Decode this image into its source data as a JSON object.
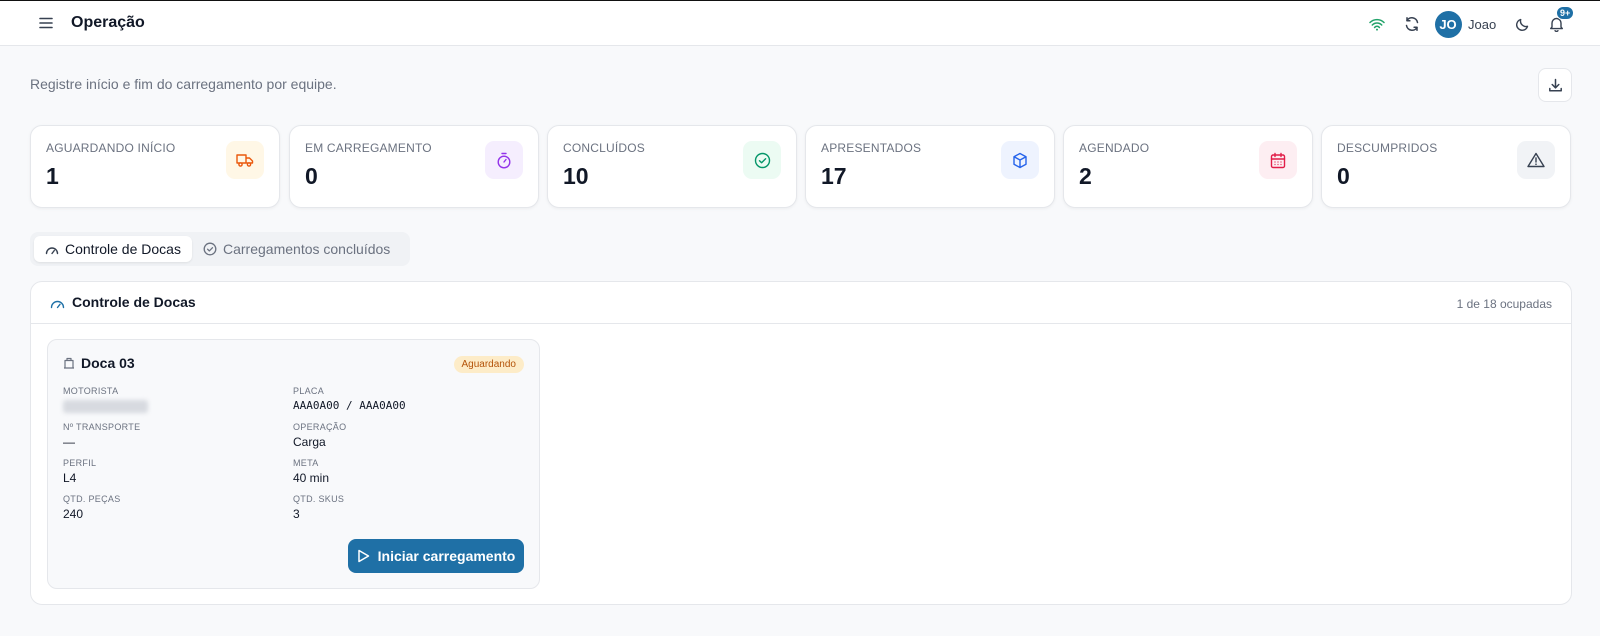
{
  "header": {
    "title": "Operação",
    "user": {
      "initials": "JO",
      "name": "Joao"
    },
    "notifications_badge": "9+",
    "icons": [
      "menu-icon",
      "wifi-icon",
      "refresh-icon",
      "moon-icon",
      "bell-icon"
    ]
  },
  "page": {
    "subtitle": "Registre início e fim do carregamento por equipe."
  },
  "stats": [
    {
      "label": "AGUARDANDO INÍCIO",
      "value": "1",
      "icon": "truck-icon",
      "color": "#ea580c",
      "bg": "#fff7e6"
    },
    {
      "label": "EM CARREGAMENTO",
      "value": "0",
      "icon": "timer-icon",
      "color": "#9333ea",
      "bg": "#f5eefe"
    },
    {
      "label": "CONCLUÍDOS",
      "value": "10",
      "icon": "check-circle-icon",
      "color": "#059669",
      "bg": "#ecfbf3"
    },
    {
      "label": "APRESENTADOS",
      "value": "17",
      "icon": "package-icon",
      "color": "#2563eb",
      "bg": "#eef3fe"
    },
    {
      "label": "AGENDADO",
      "value": "2",
      "icon": "calendar-icon",
      "color": "#e11d48",
      "bg": "#fdeef2"
    },
    {
      "label": "DESCUMPRIDOS",
      "value": "0",
      "icon": "warning-icon",
      "color": "#374151",
      "bg": "#f1f3f6"
    }
  ],
  "tabs": [
    {
      "label": "Controle de Docas",
      "active": true
    },
    {
      "label": "Carregamentos concluídos",
      "active": false
    }
  ],
  "panel": {
    "title": "Controle de Docas",
    "count": "1 de 18 ocupadas"
  },
  "dock": {
    "name": "Doca 03",
    "status": "Aguardando",
    "fields": {
      "motorista": {
        "label": "MOTORISTA",
        "value": ""
      },
      "placa": {
        "label": "PLACA",
        "value": "AAA0A00 / AAA0A00"
      },
      "transporte": {
        "label": "Nº TRANSPORTE",
        "value": "—"
      },
      "operacao": {
        "label": "OPERAÇÃO",
        "value": "Carga"
      },
      "perfil": {
        "label": "PERFIL",
        "value": "L4"
      },
      "meta": {
        "label": "META",
        "value": "40 min"
      },
      "pecas": {
        "label": "QTD. PEÇAS",
        "value": "240"
      },
      "skus": {
        "label": "QTD. SKUS",
        "value": "3"
      }
    },
    "action_label": "Iniciar carregamento"
  }
}
